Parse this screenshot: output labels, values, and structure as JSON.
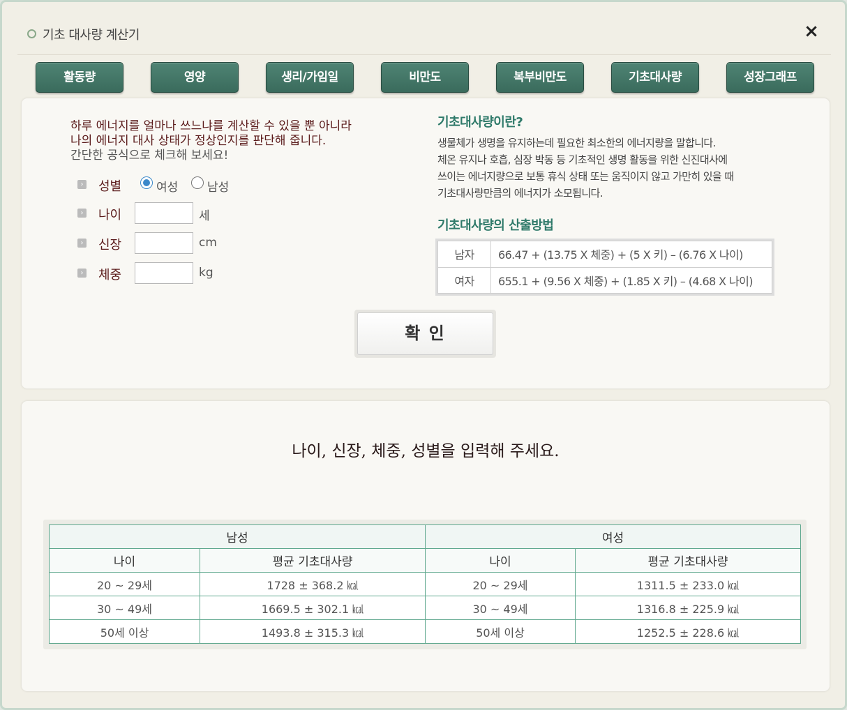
{
  "window": {
    "title": "기초 대사량 계산기",
    "close_icon": "×"
  },
  "tabs": [
    {
      "label": "활동량"
    },
    {
      "label": "영양"
    },
    {
      "label": "생리/가임일"
    },
    {
      "label": "비만도"
    },
    {
      "label": "복부비만도"
    },
    {
      "label": "기초대사량"
    },
    {
      "label": "성장그래프"
    }
  ],
  "intro": {
    "line1": "하루 에너지를 얼마나 쓰느냐를 계산할 수 있을 뿐 아니라",
    "line2": "나의 에너지 대사 상태가 정상인지를 판단해 줍니다.",
    "line3": "간단한 공식으로 체크해 보세요!"
  },
  "form": {
    "gender_label": "성별",
    "female_label": "여성",
    "male_label": "남성",
    "gender_selected": "여성",
    "age_label": "나이",
    "age_value": "",
    "age_unit": "세",
    "height_label": "신장",
    "height_value": "",
    "height_unit": "cm",
    "weight_label": "체중",
    "weight_value": "",
    "weight_unit": "kg",
    "confirm_label": "확 인"
  },
  "info": {
    "heading": "기초대사량이란?",
    "body1": "생물체가 생명을 유지하는데 필요한 최소한의 에너지량을 말합니다.",
    "body2": "체온 유지나 호흡, 심장 박동 등 기초적인 생명 활동을 위한 신진대사에",
    "body3": "쓰이는 에너지량으로 보통 휴식 상태 또는 움직이지 않고 가만히 있을 때",
    "body4": "기초대사량만큼의 에너지가 소모됩니다.",
    "method_heading": "기초대사량의 산출방법",
    "formulas": [
      {
        "gender": "남자",
        "formula": "66.47 + (13.75 X 체중) + (5 X 키) – (6.76 X 나이)"
      },
      {
        "gender": "여자",
        "formula": "655.1 + (9.56 X 체중) + (1.85 X 키) – (4.68 X 나이)"
      }
    ]
  },
  "result": {
    "prompt": "나이, 신장, 체중, 성별을 입력해 주세요."
  },
  "avg_table": {
    "male_header": "남성",
    "female_header": "여성",
    "col_age": "나이",
    "col_avg": "평균 기초대사량",
    "rows": [
      {
        "m_age": "20 ~ 29세",
        "m_avg": "1728 ± 368.2 ㎉",
        "f_age": "20 ~ 29세",
        "f_avg": "1311.5 ± 233.0 ㎉"
      },
      {
        "m_age": "30 ~ 49세",
        "m_avg": "1669.5 ± 302.1 ㎉",
        "f_age": "30 ~ 49세",
        "f_avg": "1316.8 ± 225.9 ㎉"
      },
      {
        "m_age": "50세 이상",
        "m_avg": "1493.8 ± 315.3 ㎉",
        "f_age": "50세 이상",
        "f_avg": "1252.5 ± 228.6 ㎉"
      }
    ]
  },
  "colors": {
    "tab_green": "#3a6b5c",
    "heading_green": "#2f7a6a",
    "label_maroon": "#5a1a1a",
    "table_border": "#5fa88e",
    "radio_blue": "#3b88c9"
  }
}
